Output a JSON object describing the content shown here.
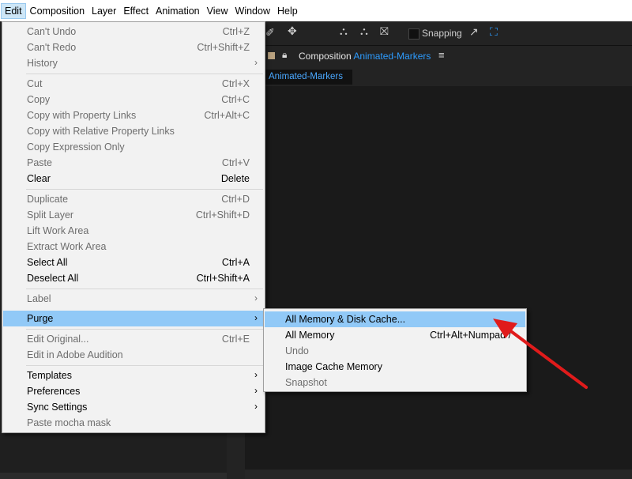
{
  "menubar": {
    "items": [
      "Edit",
      "Composition",
      "Layer",
      "Effect",
      "Animation",
      "View",
      "Window",
      "Help"
    ]
  },
  "toolbar": {
    "snapping_label": "Snapping"
  },
  "composition": {
    "panel_prefix": "Composition",
    "panel_name": "Animated-Markers",
    "tab_label": "Animated-Markers"
  },
  "edit_menu": {
    "items": [
      {
        "label": "Can't Undo",
        "shortcut": "Ctrl+Z",
        "disabled": true
      },
      {
        "label": "Can't Redo",
        "shortcut": "Ctrl+Shift+Z",
        "disabled": true
      },
      {
        "label": "History",
        "submenu": true,
        "disabled": true
      },
      {
        "label": "Cut",
        "shortcut": "Ctrl+X",
        "disabled": true
      },
      {
        "label": "Copy",
        "shortcut": "Ctrl+C",
        "disabled": true
      },
      {
        "label": "Copy with Property Links",
        "shortcut": "Ctrl+Alt+C",
        "disabled": true
      },
      {
        "label": "Copy with Relative Property Links",
        "disabled": true
      },
      {
        "label": "Copy Expression Only",
        "disabled": true
      },
      {
        "label": "Paste",
        "shortcut": "Ctrl+V",
        "disabled": true
      },
      {
        "label": "Clear",
        "shortcut": "Delete",
        "disabled": false
      },
      {
        "label": "Duplicate",
        "shortcut": "Ctrl+D",
        "disabled": true
      },
      {
        "label": "Split Layer",
        "shortcut": "Ctrl+Shift+D",
        "disabled": true
      },
      {
        "label": "Lift Work Area",
        "disabled": true
      },
      {
        "label": "Extract Work Area",
        "disabled": true
      },
      {
        "label": "Select All",
        "shortcut": "Ctrl+A",
        "disabled": false
      },
      {
        "label": "Deselect All",
        "shortcut": "Ctrl+Shift+A",
        "disabled": false
      },
      {
        "label": "Label",
        "submenu": true,
        "disabled": true
      },
      {
        "label": "Purge",
        "submenu": true,
        "disabled": false,
        "highlighted": true
      },
      {
        "label": "Edit Original...",
        "shortcut": "Ctrl+E",
        "disabled": true
      },
      {
        "label": "Edit in Adobe Audition",
        "disabled": true
      },
      {
        "label": "Templates",
        "submenu": true,
        "disabled": false
      },
      {
        "label": "Preferences",
        "submenu": true,
        "disabled": false
      },
      {
        "label": "Sync Settings",
        "submenu": true,
        "disabled": false
      },
      {
        "label": "Paste mocha mask",
        "disabled": true
      }
    ]
  },
  "purge_menu": {
    "items": [
      {
        "label": "All Memory & Disk Cache...",
        "highlighted": true
      },
      {
        "label": "All Memory",
        "shortcut": "Ctrl+Alt+Numpad /"
      },
      {
        "label": "Undo",
        "disabled": true
      },
      {
        "label": "Image Cache Memory"
      },
      {
        "label": "Snapshot",
        "disabled": true
      }
    ]
  },
  "colors": {
    "highlight": "#91c9f7",
    "annotation_arrow": "#e01b1b",
    "accent": "#2d9cff"
  }
}
